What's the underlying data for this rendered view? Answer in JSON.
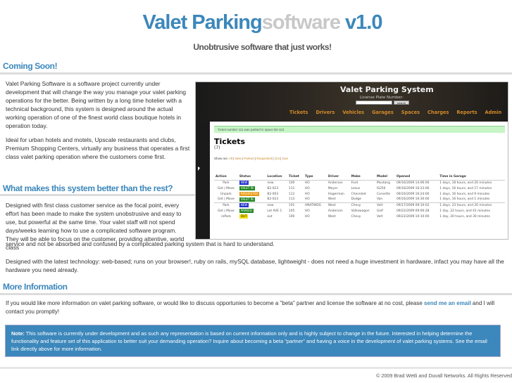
{
  "header": {
    "title_part1": "Valet Parking",
    "title_part2": "software",
    "title_part3": " v1.0",
    "subtitle": "Unobtrusive software that just works!"
  },
  "sections": {
    "coming_soon": {
      "heading": "Coming Soon!",
      "para1": "Valet Parking Software is a software project currently under development that will change the way you manage your valet parking operations for the better. Being written by a long time hotelier with a technical background, this system is designed around the actual working operation of one of the finest world class boutique hotels in operation today.",
      "para2": "Ideal for urban hotels and motels, Upscale restaurants and clubs, Premium Shopping Centers, virtually any business that operates a first class valet parking operation where the customers come first."
    },
    "better": {
      "heading": "What makes this system better than the rest?",
      "para1": "Designed with first class customer service as the focal point, every effort has been made to make the system unobstrusive and easy to use, but powerful at the same time. Your valet staff will not spend days/weeks learning how to use a complicated software program. They will be able to focus on the customer, providing attentive, world class",
      "para1_cont": "service and not be absorbed and confused by a complicated parking system that is hard to understand.",
      "para2": "Designed with the latest technology: web-based; runs on your browser!, ruby on rails, mySQL database, lightweight - does not need a huge investment in hardware, infact you may have all the hardware you need already."
    },
    "more_info": {
      "heading": "More Information",
      "text_before": "If you would like more information on valet parking software, or would like to discuss opportunies to become a \"beta\" partner and license the software at no cost, please ",
      "link": "send me an email",
      "text_after": " and I will contact you promptly!"
    }
  },
  "note": {
    "label": "Note:",
    "text": " This software is currently under development and as such any representation is based on current information only and is highly subject to change in the future. Interested in helping determine the functionality and feature set of this application to better suit your demanding operation? Inquire about becoming a beta \"partner\" and having a voice in the development of valet parking systems. See the email link directly above for more information."
  },
  "footer": {
    "copyright": "© 2009 Brad Wetli and Duvall Networks. All Rights Reserved"
  },
  "screenshot": {
    "app_title": "Valet Parking System",
    "license_label": "License Plate Number:",
    "search_button": "search",
    "nav": [
      "Tickets",
      "Drivers",
      "Vehicles",
      "Garages",
      "Spaces",
      "Charges",
      "Reports",
      "Admin"
    ],
    "flash": "Ticket number 111 was parked in space B2-113",
    "page_title": "Tickets",
    "count": "(7)",
    "filter_label": "Show me: ",
    "filters": [
      "All",
      "New",
      "Parked",
      "Requested",
      "Out",
      "Due"
    ],
    "columns": [
      "Action",
      "Status",
      "Location",
      "Ticket",
      "Type",
      "Driver",
      "Make",
      "Model",
      "Opened",
      "Time in Garage"
    ],
    "rows": [
      {
        "action": "Park",
        "status": "NEW",
        "status_type": "new",
        "location": "new",
        "ticket": "100",
        "type": "HO",
        "driver": "Anderson",
        "make": "Ford",
        "model": "Mustang",
        "opened": "09/16/2009 14:06:00",
        "time": "1 days, 18 hours, and 20 minutes"
      },
      {
        "action": "Get | Move",
        "status": "VALET IN",
        "status_type": "valet",
        "location": "B2-023",
        "ticket": "111",
        "type": "HO",
        "driver": "Meyer",
        "make": "Lexus",
        "model": "IS250",
        "opened": "09/16/2009 16:23:00",
        "time": "1 days, 16 hours, and 17 minutes"
      },
      {
        "action": "Unpark",
        "status": "REQUESTED",
        "status_type": "req",
        "location": "B2-003",
        "ticket": "112",
        "type": "HO",
        "driver": "Hagerman",
        "make": "Chevrolet",
        "model": "Corvette",
        "opened": "09/16/2009 16:24:00",
        "time": "1 days, 16 hours, and 9 minutes"
      },
      {
        "action": "Get | Move",
        "status": "VALET IN",
        "status_type": "valet",
        "location": "B2-023",
        "ticket": "113",
        "type": "HO",
        "driver": "West",
        "make": "Dodge",
        "model": "Van",
        "opened": "09/16/2009 16:30:00",
        "time": "1 days, 16 hours, and 1 minutes"
      },
      {
        "action": "Park",
        "status": "NEW",
        "status_type": "new",
        "location": "new",
        "ticket": "101",
        "type": "HNATWDG",
        "driver": "West",
        "make": "Chevy",
        "model": "Volt",
        "opened": "09/17/2009 09:10:02",
        "time": "1 days, 23 hours, and 20 minutes"
      },
      {
        "action": "Get | Move",
        "status": "PARKED",
        "status_type": "park",
        "location": "Lot AVE 1",
        "ticket": "105",
        "type": "HO",
        "driver": "Anderson",
        "make": "Volkswagon",
        "model": "Golf",
        "opened": "09/22/2009 09:00:28",
        "time": "1 day, 22 hours, and 41 minutes"
      },
      {
        "action": "rePark",
        "status": "OUT",
        "status_type": "out",
        "location": "out",
        "ticket": "100",
        "type": "HO",
        "driver": "West",
        "make": "Chevy",
        "model": "Volt",
        "opened": "09/22/2009 10:10:00",
        "time": "1 day, 20 hours, and 30 minutes"
      }
    ]
  }
}
